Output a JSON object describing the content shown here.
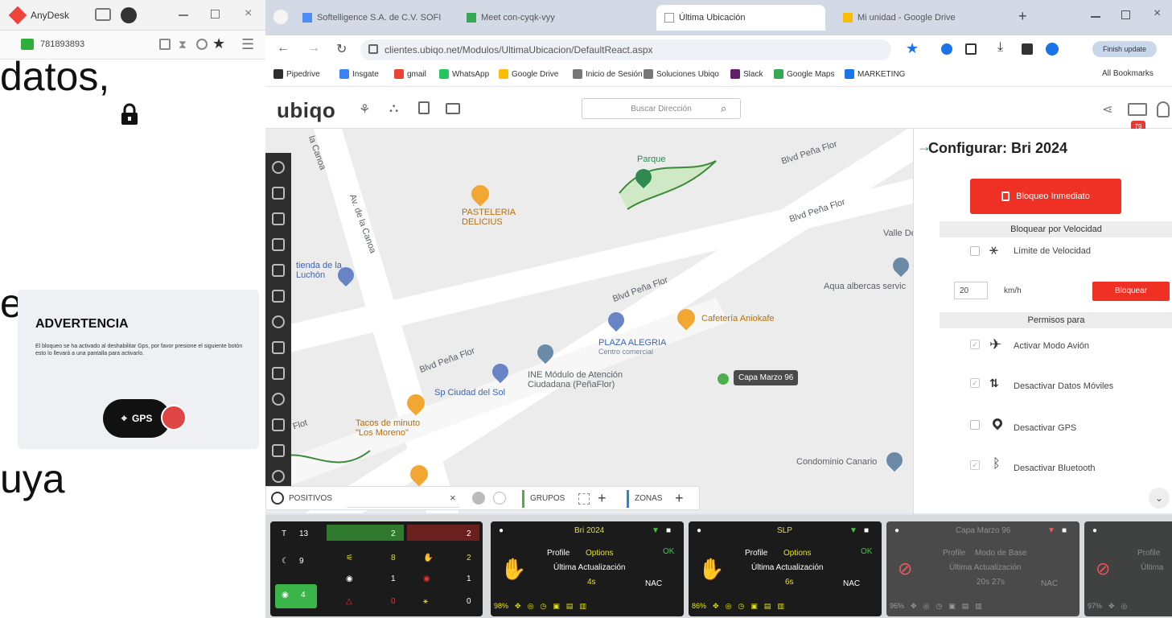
{
  "anydesk": {
    "app_name": "AnyDesk",
    "session_id": "781893893"
  },
  "slide": {
    "text_top": "datos,",
    "text_mid": "etc",
    "text_bottom": "uya",
    "warning_title": "ADVERTENCIA",
    "warning_body": "El bloqueo se ha activado al deshabilitar Gps, por favor presione el siguiente botón esto lo llevará a una pantalla para activarlo.",
    "gps_label": "GPS"
  },
  "browser": {
    "tabs": [
      {
        "label": "Softelligence S.A. de C.V. SOFI"
      },
      {
        "label": "Meet con-cyqk-vyy"
      },
      {
        "label": "Última Ubicación"
      },
      {
        "label": "Mi unidad - Google Drive"
      }
    ],
    "url": "clientes.ubiqo.net/Modulos/UltimaUbicacion/DefaultReact.aspx",
    "update_label": "Finish update",
    "bookmarks": [
      {
        "label": "Pipedrive",
        "color": "#2d2d2d"
      },
      {
        "label": "Insgate",
        "color": "#3b82f6"
      },
      {
        "label": "gmail",
        "color": "#ea4335"
      },
      {
        "label": "WhatsApp",
        "color": "#22c55e"
      },
      {
        "label": "Google Drive",
        "color": "#fbbc04"
      },
      {
        "label": "Inicio de Sesión",
        "color": "#777777"
      },
      {
        "label": "Soluciones Ubiqo",
        "color": "#777777"
      },
      {
        "label": "Slack",
        "color": "#611f69"
      },
      {
        "label": "Google Maps",
        "color": "#34a853"
      },
      {
        "label": "MARKETING",
        "color": "#1a73e8"
      }
    ],
    "all_bookmarks": "All Bookmarks"
  },
  "app": {
    "logo": "ubiqo",
    "search_placeholder": "Buscar Dirección",
    "badge_count": "79"
  },
  "map": {
    "labels": {
      "blvd1": "Blvd Peña Flor",
      "blvd2": "Blvd Peña Flor",
      "blvd3": "Blvd Peña Flor",
      "blvd4": "Blvd Peña Flor",
      "parque": "Parque",
      "pasteleria": "PASTELERIA DELICIUS",
      "av_canoa": "Av. de la Canoa",
      "luchon": "tienda de la Luchón",
      "plaza": "PLAZA ALEGRIA",
      "plaza_sub": "Centro comercial",
      "ine": "INE Módulo de Atención Ciudadana (PeñaFlor)",
      "sp_ciudad": "Sp Ciudad del Sol",
      "cafeteria": "Cafetería Aniokafe",
      "tacos": "Tacos de minuto \"Los Moreno\"",
      "aqua": "Aqua albercas servic",
      "condominio": "Condominio Canario",
      "valle": "Valle De",
      "flot": "Flot",
      "vehicle": "Capa Marzo 96",
      "canoa_top": "la Canoa"
    }
  },
  "config": {
    "title": "Configurar: Bri 2024",
    "immediate_button": "Bloqueo Inmediato",
    "speed_section": "Bloquear por Velocidad",
    "speed_limit_label": "Límite de Velocidad",
    "speed_value": "20",
    "speed_unit": "km/h",
    "block_button": "Bloquear",
    "perms_section": "Permisos para",
    "perms": [
      {
        "label": "Activar Modo Avión",
        "checked": true
      },
      {
        "label": "Desactivar Datos Móviles",
        "checked": true
      },
      {
        "label": "Desactivar GPS",
        "checked": false
      },
      {
        "label": "Desactivar Bluetooth",
        "checked": true
      }
    ]
  },
  "filterbar": {
    "devices_label": "POSITIVOS",
    "groups_label": "GRUPOS",
    "zones_label": "ZONAS"
  },
  "summary": {
    "t_label": "T",
    "t_value": "13",
    "moon_value": "9",
    "eye_value": "4",
    "green_count": "2",
    "red_count": "2",
    "row2_a": "8",
    "row2_b": "2",
    "row3_a": "1",
    "row3_b": "1",
    "row4_a": "0",
    "row4_b": "0"
  },
  "devices": [
    {
      "name": "Bri 2024",
      "profile": "Profile",
      "option": "Options",
      "ultima": "Última Actualización",
      "time": "4s",
      "nac": "NAC",
      "battery": "98%"
    },
    {
      "name": "SLP",
      "profile": "Profile",
      "option": "Options",
      "ultima": "Última Actualización",
      "time": "6s",
      "nac": "NAC",
      "battery": "86%"
    },
    {
      "name": "Capa Marzo 96",
      "profile": "Profile",
      "option": "Modo de Base",
      "ultima": "Última Actualización",
      "time": "20s 27s",
      "nac": "NAC",
      "battery": "96%"
    },
    {
      "name": "",
      "profile": "Profile",
      "option": "",
      "ultima": "Última",
      "time": "",
      "nac": "",
      "battery": "97%"
    }
  ],
  "status_ok": "OK"
}
